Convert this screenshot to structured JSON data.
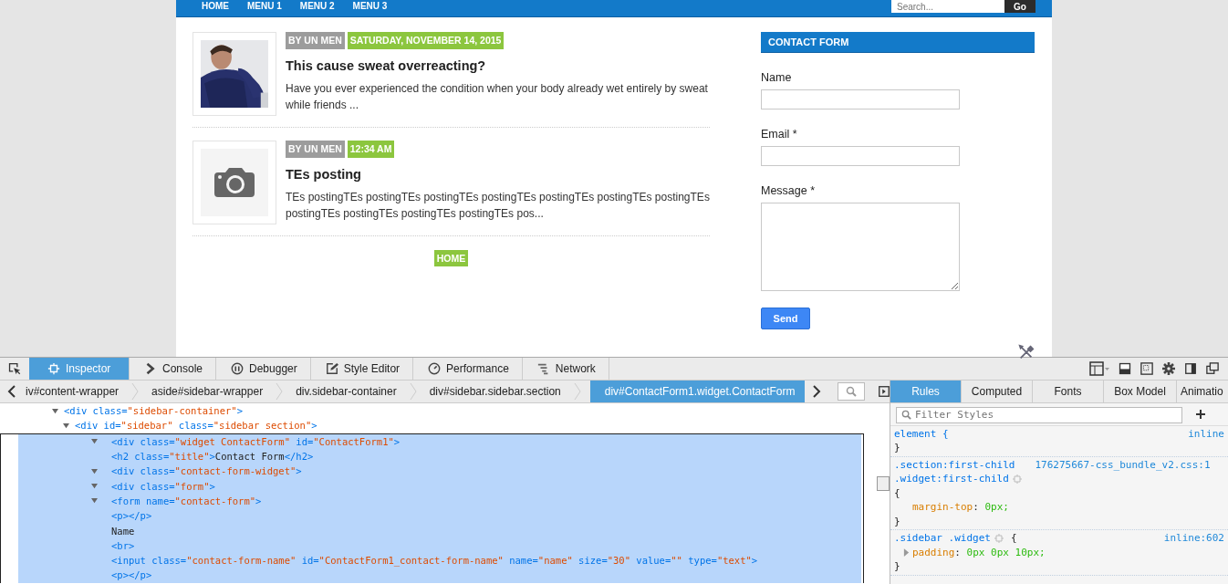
{
  "nav": {
    "items": [
      {
        "label": "HOME"
      },
      {
        "label": "MENU 1"
      },
      {
        "label": "MENU 2"
      },
      {
        "label": "MENU 3"
      }
    ],
    "search": {
      "placeholder": "Search...",
      "button": "Go"
    }
  },
  "posts": [
    {
      "author": "BY UN MEN",
      "date": "SATURDAY, NOVEMBER 14, 2015",
      "title": "This cause sweat overreacting?",
      "excerpt": "Have you ever experienced the condition when your body already wet entirely by sweat while friends ..."
    },
    {
      "thumb": {
        "kind": "placeholder"
      },
      "author": "BY UN MEN",
      "date": "12:34 AM",
      "title": "TEs posting",
      "excerpt": "TEs postingTEs postingTEs postingTEs postingTEs postingTEs postingTEs postingTEs postingTEs postingTEs postingTEs postingTEs pos..."
    }
  ],
  "home_button": "HOME",
  "contact_form": {
    "title": "CONTACT FORM",
    "fields": [
      {
        "label": "Name",
        "kind": "input"
      },
      {
        "label": "Email *",
        "kind": "input"
      },
      {
        "label": "Message *",
        "kind": "textarea"
      }
    ],
    "send": "Send"
  },
  "devtools": {
    "tabs": [
      {
        "label": "Inspector",
        "selected": true
      },
      {
        "label": "Console",
        "selected": false
      },
      {
        "label": "Debugger",
        "selected": false
      },
      {
        "label": "Style Editor",
        "selected": false
      },
      {
        "label": "Performance",
        "selected": false
      },
      {
        "label": "Network",
        "selected": false
      }
    ],
    "breadcrumbs": [
      {
        "label": "iv#content-wrapper",
        "selected": false
      },
      {
        "label": "aside#sidebar-wrapper",
        "selected": false
      },
      {
        "label": "div.sidebar-container",
        "selected": false
      },
      {
        "label": "div#sidebar.sidebar.section",
        "selected": false
      },
      {
        "label": "div#ContactForm1.widget.ContactForm",
        "selected": true
      }
    ],
    "markup": [
      {
        "twisty": true,
        "selected": false,
        "tokens": [
          {
            "kind": "tag",
            "text": "<div "
          },
          {
            "kind": "attr",
            "text": "class="
          },
          {
            "kind": "value",
            "text": "\"sidebar-container\""
          },
          {
            "kind": "tag",
            "text": ">"
          }
        ],
        "children": [
          {
            "twisty": true,
            "selected": false,
            "tokens": [
              {
                "kind": "tag",
                "text": "<div "
              },
              {
                "kind": "attr",
                "text": "id="
              },
              {
                "kind": "value",
                "text": "\"sidebar\""
              },
              {
                "kind": "attr",
                "text": " class="
              },
              {
                "kind": "value",
                "text": "\"sidebar section\""
              },
              {
                "kind": "tag",
                "text": ">"
              }
            ],
            "children": [
              {
                "twisty": true,
                "selected": true,
                "tokens": [
                  {
                    "kind": "tag",
                    "text": "<div "
                  },
                  {
                    "kind": "attr",
                    "text": "class="
                  },
                  {
                    "kind": "value",
                    "text": "\"widget ContactForm\""
                  },
                  {
                    "kind": "attr",
                    "text": " id="
                  },
                  {
                    "kind": "value",
                    "text": "\"ContactForm1\""
                  },
                  {
                    "kind": "tag",
                    "text": ">"
                  }
                ]
              },
              {
                "twisty": false,
                "selected": true,
                "tokens": [
                  {
                    "kind": "tag",
                    "text": "<h2 "
                  },
                  {
                    "kind": "attr",
                    "text": "class="
                  },
                  {
                    "kind": "value",
                    "text": "\"title\""
                  },
                  {
                    "kind": "tag",
                    "text": ">"
                  },
                  {
                    "kind": "text",
                    "text": "Contact Form"
                  },
                  {
                    "kind": "tag",
                    "text": "</h2>"
                  }
                ]
              },
              {
                "twisty": true,
                "selected": true,
                "tokens": [
                  {
                    "kind": "tag",
                    "text": "<div "
                  },
                  {
                    "kind": "attr",
                    "text": "class="
                  },
                  {
                    "kind": "value",
                    "text": "\"contact-form-widget\""
                  },
                  {
                    "kind": "tag",
                    "text": ">"
                  }
                ]
              },
              {
                "twisty": true,
                "selected": true,
                "tokens": [
                  {
                    "kind": "tag",
                    "text": "<div "
                  },
                  {
                    "kind": "attr",
                    "text": "class="
                  },
                  {
                    "kind": "value",
                    "text": "\"form\""
                  },
                  {
                    "kind": "tag",
                    "text": ">"
                  }
                ]
              },
              {
                "twisty": true,
                "selected": true,
                "tokens": [
                  {
                    "kind": "tag",
                    "text": "<form "
                  },
                  {
                    "kind": "attr",
                    "text": "name="
                  },
                  {
                    "kind": "value",
                    "text": "\"contact-form\""
                  },
                  {
                    "kind": "tag",
                    "text": ">"
                  }
                ]
              },
              {
                "twisty": false,
                "selected": true,
                "tokens": [
                  {
                    "kind": "tag",
                    "text": "<p></p>"
                  }
                ]
              },
              {
                "twisty": false,
                "selected": true,
                "tokens": [
                  {
                    "kind": "text",
                    "text": "Name"
                  }
                ]
              },
              {
                "twisty": false,
                "selected": true,
                "tokens": [
                  {
                    "kind": "tag",
                    "text": "<br>"
                  }
                ]
              },
              {
                "twisty": false,
                "selected": true,
                "tokens": [
                  {
                    "kind": "tag",
                    "text": "<input "
                  },
                  {
                    "kind": "attr",
                    "text": "class="
                  },
                  {
                    "kind": "value",
                    "text": "\"contact-form-name\""
                  },
                  {
                    "kind": "attr",
                    "text": " id="
                  },
                  {
                    "kind": "value",
                    "text": "\"ContactForm1_contact-form-name\""
                  },
                  {
                    "kind": "attr",
                    "text": " name="
                  },
                  {
                    "kind": "value",
                    "text": "\"name\""
                  },
                  {
                    "kind": "attr",
                    "text": " size="
                  },
                  {
                    "kind": "value",
                    "text": "\"30\""
                  },
                  {
                    "kind": "attr",
                    "text": " value="
                  },
                  {
                    "kind": "value",
                    "text": "\"\""
                  },
                  {
                    "kind": "attr",
                    "text": " type="
                  },
                  {
                    "kind": "value",
                    "text": "\"text\""
                  },
                  {
                    "kind": "tag",
                    "text": ">"
                  }
                ]
              },
              {
                "twisty": false,
                "selected": true,
                "tokens": [
                  {
                    "kind": "tag",
                    "text": "<p></p>"
                  }
                ]
              }
            ]
          }
        ]
      }
    ],
    "side_tabs": [
      {
        "label": "Rules",
        "selected": true
      },
      {
        "label": "Computed",
        "selected": false
      },
      {
        "label": "Fonts",
        "selected": false
      },
      {
        "label": "Box Model",
        "selected": false
      },
      {
        "label": "Animatio",
        "selected": false
      }
    ],
    "filter": {
      "placeholder": "Filter Styles"
    },
    "rules": [
      {
        "selector": [
          "element {"
        ],
        "source": "inline",
        "close": "}"
      },
      {
        "selector": [
          ".section:first-child",
          ".widget:first-child"
        ],
        "source": "176275667-css_bundle_v2.css:1",
        "open": "{",
        "props": [
          {
            "name": "margin-top",
            "colon": ":",
            "value": "0px;",
            "expander": false
          }
        ],
        "close": "}"
      },
      {
        "selector": [
          ".sidebar .widget"
        ],
        "source": "inline:602",
        "brace": "{",
        "props": [
          {
            "name": "padding",
            "colon": ":",
            "value": "0px 0px 10px;",
            "expander": true
          }
        ],
        "close": "}"
      }
    ]
  }
}
